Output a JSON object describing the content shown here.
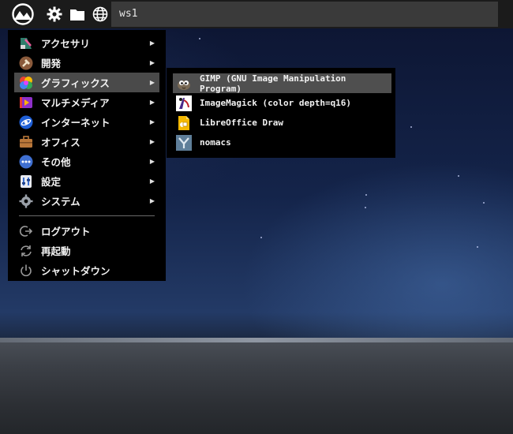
{
  "panel": {
    "workspace_label": "ws1",
    "icons": [
      "logo-icon",
      "gear-icon",
      "folder-icon",
      "globe-icon"
    ]
  },
  "menu": {
    "items": [
      {
        "label": "アクセサリ",
        "icon": "accessories-icon",
        "has_submenu": true
      },
      {
        "label": "開発",
        "icon": "development-icon",
        "has_submenu": true
      },
      {
        "label": "グラフィックス",
        "icon": "graphics-icon",
        "has_submenu": true,
        "active": true
      },
      {
        "label": "マルチメディア",
        "icon": "multimedia-icon",
        "has_submenu": true
      },
      {
        "label": "インターネット",
        "icon": "internet-icon",
        "has_submenu": true
      },
      {
        "label": "オフィス",
        "icon": "office-icon",
        "has_submenu": true
      },
      {
        "label": "その他",
        "icon": "other-icon",
        "has_submenu": true
      },
      {
        "label": "設定",
        "icon": "settings-icon",
        "has_submenu": true
      },
      {
        "label": "システム",
        "icon": "system-icon",
        "has_submenu": true
      }
    ],
    "session": [
      {
        "label": "ログアウト",
        "icon": "logout-icon"
      },
      {
        "label": "再起動",
        "icon": "restart-icon"
      },
      {
        "label": "シャットダウン",
        "icon": "shutdown-icon"
      }
    ],
    "arrow": "▶"
  },
  "submenu": {
    "items": [
      {
        "label": "GIMP (GNU Image Manipulation Program)",
        "icon": "gimp-icon",
        "active": true
      },
      {
        "label": "ImageMagick (color depth=q16)",
        "icon": "imagemagick-icon"
      },
      {
        "label": "LibreOffice Draw",
        "icon": "libreoffice-draw-icon"
      },
      {
        "label": "nomacs",
        "icon": "nomacs-icon"
      }
    ]
  }
}
